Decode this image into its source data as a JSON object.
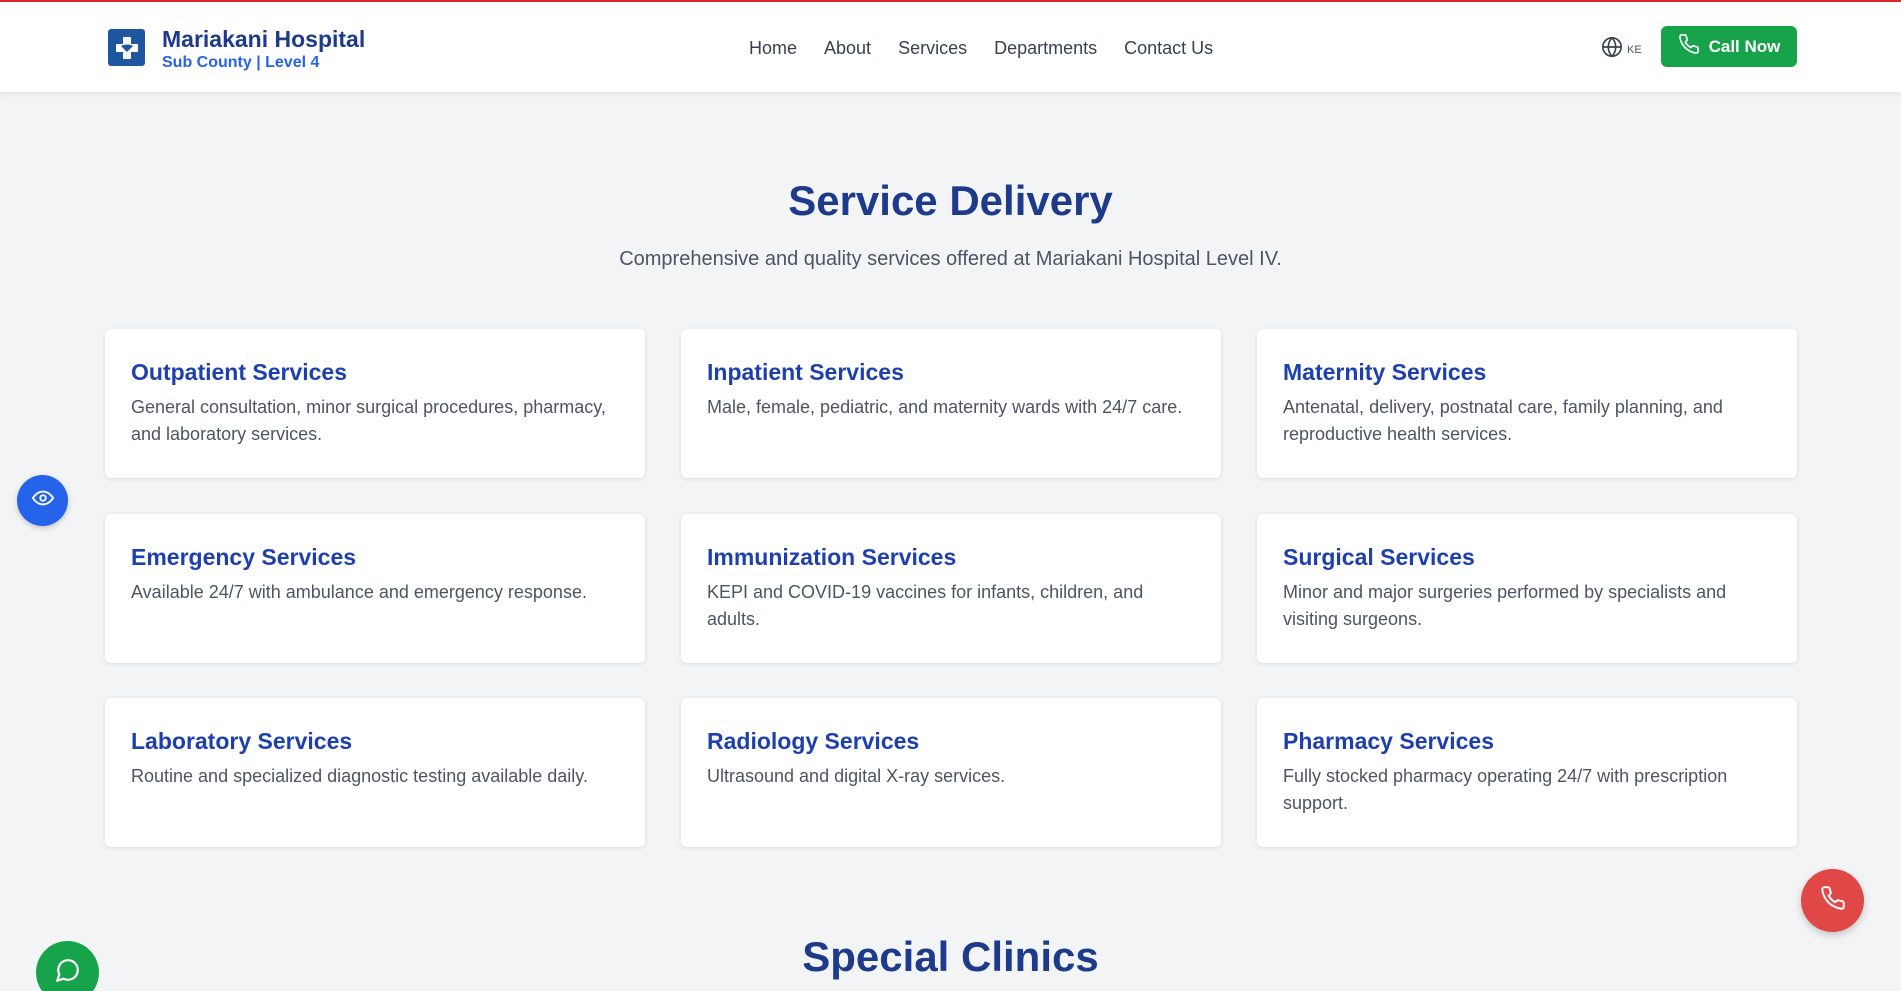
{
  "header": {
    "brand_name": "Mariakani Hospital",
    "brand_sub": "Sub County | Level 4",
    "nav": [
      "Home",
      "About",
      "Services",
      "Departments",
      "Contact Us"
    ],
    "lang_code": "KE",
    "call_label": "Call Now"
  },
  "service_delivery": {
    "title": "Service Delivery",
    "subtitle": "Comprehensive and quality services offered at Mariakani Hospital Level IV.",
    "cards": [
      {
        "title": "Outpatient Services",
        "desc": "General consultation, minor surgical procedures, pharmacy, and laboratory services."
      },
      {
        "title": "Inpatient Services",
        "desc": "Male, female, pediatric, and maternity wards with 24/7 care."
      },
      {
        "title": "Maternity Services",
        "desc": "Antenatal, delivery, postnatal care, family planning, and reproductive health services."
      },
      {
        "title": "Emergency Services",
        "desc": "Available 24/7 with ambulance and emergency response."
      },
      {
        "title": "Immunization Services",
        "desc": "KEPI and COVID-19 vaccines for infants, children, and adults."
      },
      {
        "title": "Surgical Services",
        "desc": "Minor and major surgeries performed by specialists and visiting surgeons."
      },
      {
        "title": "Laboratory Services",
        "desc": "Routine and specialized diagnostic testing available daily."
      },
      {
        "title": "Radiology Services",
        "desc": "Ultrasound and digital X-ray services."
      },
      {
        "title": "Pharmacy Services",
        "desc": "Fully stocked pharmacy operating 24/7 with prescription support."
      }
    ]
  },
  "special_clinics": {
    "title": "Special Clinics"
  },
  "icons": {
    "logo": "hospital-cross-icon",
    "lang": "globe-icon",
    "call": "phone-icon",
    "accessibility": "eye-icon",
    "chat": "chat-bubble-icon",
    "floating_call": "phone-icon"
  },
  "colors": {
    "accent_top": "#dc2626",
    "brand_blue": "#1e3a8a",
    "card_title": "#1e40af",
    "call_green": "#16a34a",
    "fab_blue": "#2563eb",
    "fab_red": "#e04848"
  }
}
